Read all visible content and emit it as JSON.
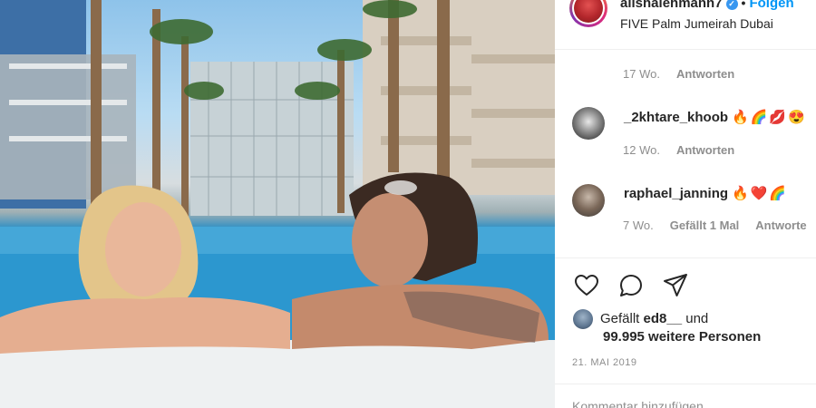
{
  "post_header": {
    "username": "alishalehmann7",
    "follow_label": "Folgen",
    "location": "FIVE Palm Jumeirah Dubai"
  },
  "comments": [
    {
      "time": "17 Wo.",
      "reply_label": "Antworten"
    },
    {
      "username": "_2khtare_khoob",
      "emojis": "🔥🌈💋😍",
      "time": "12 Wo.",
      "reply_label": "Antworten"
    },
    {
      "username": "raphael_janning",
      "emojis": "🔥❤️🌈",
      "time": "7 Wo.",
      "likes": "Gefällt 1 Mal",
      "reply_label": "Antworte"
    }
  ],
  "actions": {
    "like_icon": "heart-icon",
    "comment_icon": "comment-icon",
    "share_icon": "paper-plane-icon"
  },
  "likes": {
    "prefix": "Gefällt",
    "liker": "ed8__",
    "conjunction": "und",
    "others": "99.995 weitere Personen"
  },
  "date": "21. MAI 2019",
  "add_comment_placeholder": "Kommentar hinzufügen ...",
  "colors": {
    "accent": "#0095f6",
    "text": "#262626",
    "muted": "#8e8e8e"
  }
}
